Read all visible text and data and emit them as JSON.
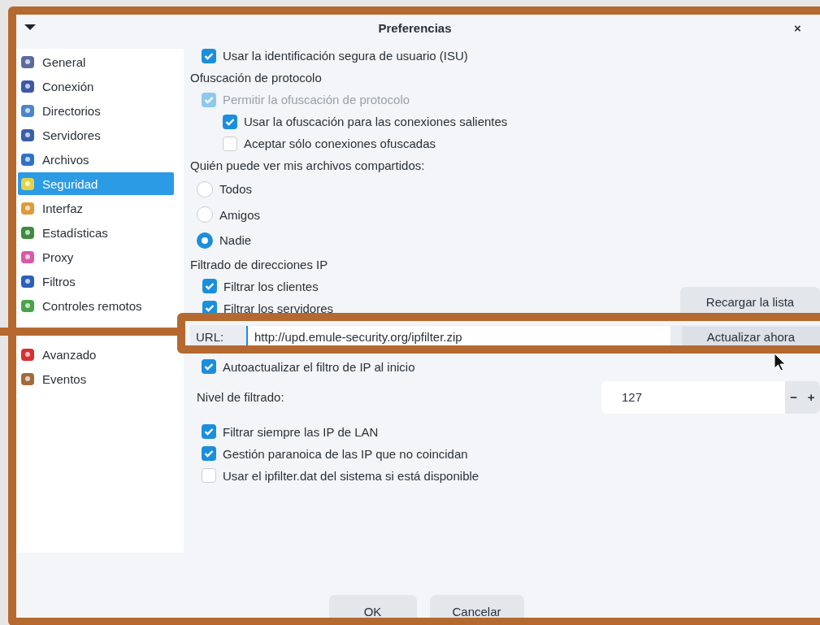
{
  "window": {
    "title": "Preferencias",
    "close": "×"
  },
  "sidebar": {
    "items": [
      {
        "label": "General",
        "selected": false
      },
      {
        "label": "Conexión",
        "selected": false
      },
      {
        "label": "Directorios",
        "selected": false
      },
      {
        "label": "Servidores",
        "selected": false
      },
      {
        "label": "Archivos",
        "selected": false
      },
      {
        "label": "Seguridad",
        "selected": true
      },
      {
        "label": "Interfaz",
        "selected": false
      },
      {
        "label": "Estadísticas",
        "selected": false
      },
      {
        "label": "Proxy",
        "selected": false
      },
      {
        "label": "Filtros",
        "selected": false
      },
      {
        "label": "Controles remotos",
        "selected": false
      },
      {
        "kind": "covered"
      },
      {
        "label": "Avanzado",
        "selected": false
      },
      {
        "label": "Eventos",
        "selected": false
      }
    ]
  },
  "rows": [
    {
      "kind": "checkbox",
      "label": "Usar la identificación segura de usuario (ISU)",
      "checked": true,
      "disabled": false
    },
    {
      "kind": "heading",
      "label": "Ofuscación de protocolo"
    },
    {
      "kind": "checkbox",
      "label": "Permitir la ofuscación de protocolo",
      "checked": true,
      "disabled": true,
      "children": [
        {
          "kind": "checkbox",
          "label": "Usar la ofuscación para las conexiones salientes",
          "checked": true,
          "disabled": false
        },
        {
          "kind": "checkbox",
          "label": "Aceptar sólo conexiones ofuscadas",
          "checked": false,
          "disabled": false
        }
      ]
    },
    {
      "kind": "heading",
      "label": "Quién puede ver mis archivos compartidos:"
    },
    {
      "kind": "radio",
      "label": "Todos",
      "selected": false
    },
    {
      "kind": "radio",
      "label": "Amigos",
      "selected": false
    },
    {
      "kind": "radio",
      "label": "Nadie",
      "selected": true
    },
    {
      "kind": "heading",
      "label": "Filtrado de direcciones IP"
    },
    {
      "kind": "checkgroup",
      "button": "Recargar la lista",
      "items": [
        {
          "kind": "checkbox",
          "label": "Filtrar los clientes",
          "checked": true,
          "disabled": false
        },
        {
          "kind": "checkbox",
          "label": "Filtrar los servidores",
          "checked": true,
          "disabled": false
        }
      ]
    },
    {
      "kind": "url",
      "label": "URL:",
      "value": "http://upd.emule-security.org/ipfilter.zip",
      "button": "Actualizar ahora"
    },
    {
      "kind": "checkbox",
      "label": "Autoactualizar el filtro de IP al inicio",
      "checked": true,
      "disabled": false
    },
    {
      "kind": "spin",
      "label": "Nivel de filtrado:",
      "value": "127",
      "minus": "−",
      "plus": "+"
    },
    {
      "kind": "checkbox",
      "label": "Filtrar siempre las IP de LAN",
      "checked": true,
      "disabled": false
    },
    {
      "kind": "checkbox",
      "label": "Gestión paranoica de las IP que no coincidan",
      "checked": true,
      "disabled": false
    },
    {
      "kind": "checkbox",
      "label": "Usar el ipfilter.dat del sistema si está disponible",
      "checked": false,
      "disabled": false
    }
  ],
  "footer": {
    "buttons": [
      "OK",
      "Cancelar"
    ]
  },
  "highlights": [
    {
      "kind": "dialog-frame"
    },
    {
      "kind": "url-frame"
    },
    {
      "kind": "leader"
    }
  ]
}
